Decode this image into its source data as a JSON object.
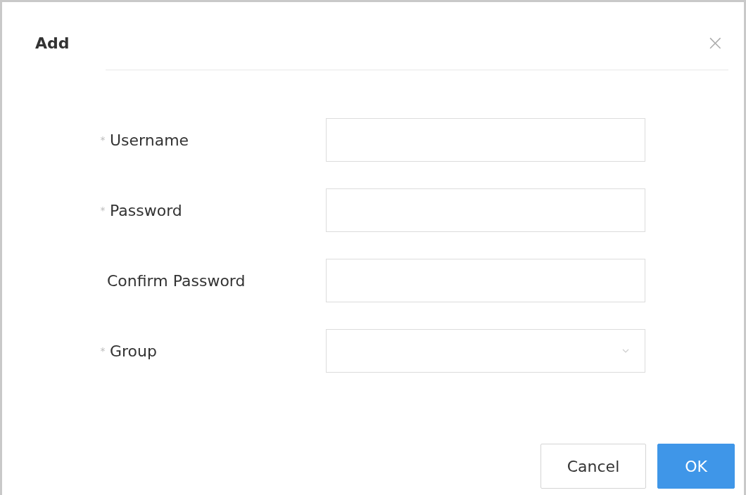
{
  "dialog": {
    "title": "Add",
    "close": "×"
  },
  "fields": [
    {
      "label": "Username",
      "marker": "*",
      "kind": "input"
    },
    {
      "label": "Password",
      "marker": "*",
      "kind": "password"
    },
    {
      "label": "Confirm Password",
      "kind": "password"
    },
    {
      "label": "Group",
      "marker": "*",
      "kind": "select"
    }
  ],
  "buttons": [
    {
      "label": "Cancel",
      "primary": false
    },
    {
      "label": "OK",
      "primary": true
    }
  ]
}
